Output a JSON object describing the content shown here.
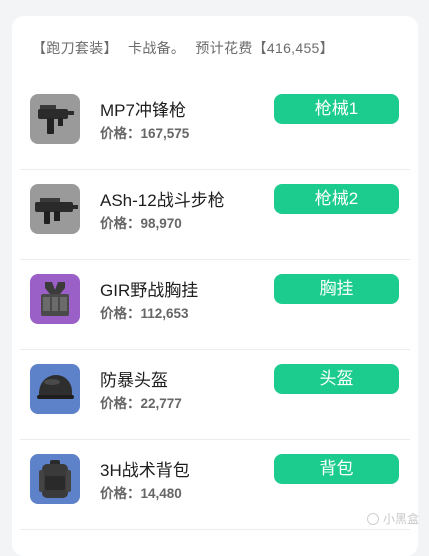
{
  "header": {
    "set_label": "【跑刀套装】",
    "subtitle": "卡战备。",
    "estimate": "预计花费【416,455】"
  },
  "items": [
    {
      "name": "MP7冲锋枪",
      "price": "价格：167,575",
      "tag": "枪械1",
      "icon": "smg-icon"
    },
    {
      "name": "ASh-12战斗步枪",
      "price": "价格：98,970",
      "tag": "枪械2",
      "icon": "rifle-icon"
    },
    {
      "name": "GIR野战胸挂",
      "price": "价格：112,653",
      "tag": "胸挂",
      "icon": "chest-rig-icon"
    },
    {
      "name": "防暴头盔",
      "price": "价格：22,777",
      "tag": "头盔",
      "icon": "helmet-icon"
    },
    {
      "name": "3H战术背包",
      "price": "价格：14,480",
      "tag": "背包",
      "icon": "backpack-icon"
    }
  ],
  "colors": {
    "tag_bg": "#1ccc8e",
    "thumb_gray": "#9a9a9a",
    "thumb_purple": "#9b5fc8",
    "thumb_blue": "#5d82c9"
  },
  "watermark": "小黑盒"
}
